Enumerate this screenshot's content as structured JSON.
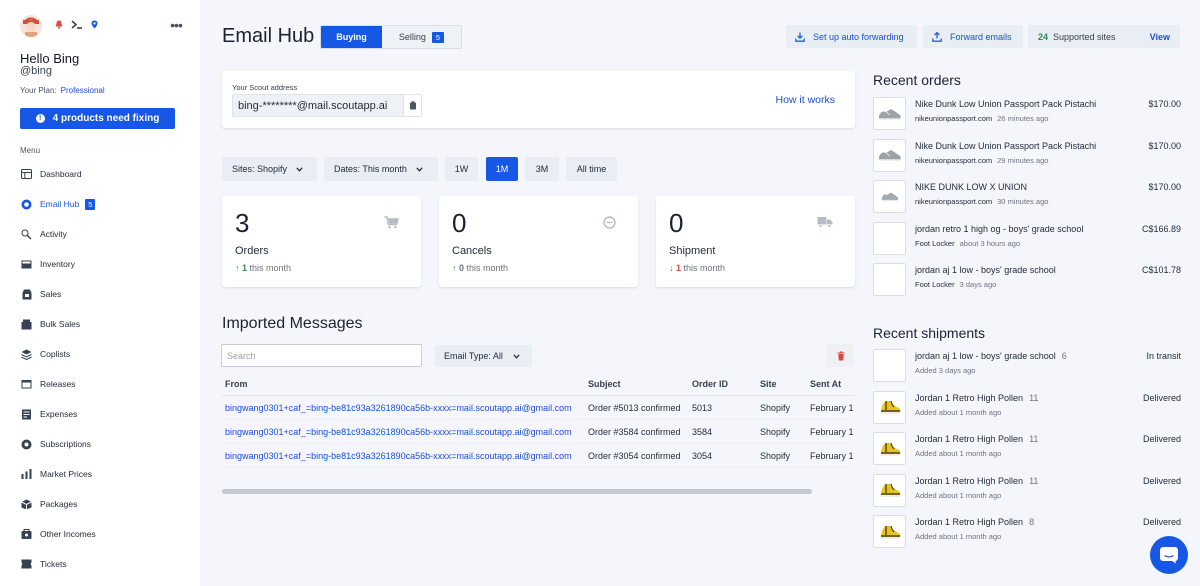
{
  "sidebar": {
    "greeting": "Hello Bing",
    "handle": "@bing",
    "plan_label": "Your Plan:",
    "plan_value": "Professional",
    "fix_button": "4 products need fixing",
    "menu_label": "Menu",
    "items": [
      {
        "label": "Dashboard",
        "icon": "dashboard-icon"
      },
      {
        "label": "Email Hub",
        "icon": "email-hub-icon",
        "badge": "5",
        "active": true
      },
      {
        "label": "Activity",
        "icon": "activity-icon"
      },
      {
        "label": "Inventory",
        "icon": "inventory-icon"
      },
      {
        "label": "Sales",
        "icon": "sales-icon"
      },
      {
        "label": "Bulk Sales",
        "icon": "bulk-sales-icon"
      },
      {
        "label": "Coplists",
        "icon": "coplists-icon"
      },
      {
        "label": "Releases",
        "icon": "releases-icon"
      },
      {
        "label": "Expenses",
        "icon": "expenses-icon"
      },
      {
        "label": "Subscriptions",
        "icon": "subscriptions-icon"
      },
      {
        "label": "Market Prices",
        "icon": "market-prices-icon"
      },
      {
        "label": "Packages",
        "icon": "packages-icon"
      },
      {
        "label": "Other Incomes",
        "icon": "other-incomes-icon"
      },
      {
        "label": "Tickets",
        "icon": "tickets-icon"
      }
    ]
  },
  "header": {
    "title": "Email Hub",
    "tab_buying": "Buying",
    "tab_selling": "Selling",
    "selling_badge": "5",
    "auto_forward": "Set up auto forwarding",
    "forward_emails": "Forward emails",
    "supported_count": "24",
    "supported_label": "Supported sites",
    "view": "View"
  },
  "scout": {
    "label": "Your Scout address",
    "address": "bing-********@mail.scoutapp.ai",
    "how_it_works": "How it works"
  },
  "filters": {
    "sites": "Sites: Shopify",
    "dates": "Dates: This month",
    "ranges": [
      "1W",
      "1M",
      "3M",
      "All time"
    ],
    "active_range": "1M"
  },
  "stats": [
    {
      "value": "3",
      "label": "Orders",
      "change": "1",
      "suffix": "this month",
      "direction": "up",
      "icon": "cart-icon"
    },
    {
      "value": "0",
      "label": "Cancels",
      "change": "0",
      "suffix": "this month",
      "direction": "up",
      "icon": "cancel-circle-icon"
    },
    {
      "value": "0",
      "label": "Shipment",
      "change": "1",
      "suffix": "this month",
      "direction": "down",
      "icon": "truck-icon"
    }
  ],
  "messages": {
    "title": "Imported Messages",
    "search_placeholder": "Search",
    "email_type": "Email Type: All",
    "columns": [
      "From",
      "Subject",
      "Order ID",
      "Site",
      "Sent At"
    ],
    "rows": [
      {
        "from": "bingwang0301+caf_=bing-be81c93a3261890ca56b-xxxx=mail.scoutapp.ai@gmail.com",
        "subject": "Order #5013 confirmed",
        "order_id": "5013",
        "site": "Shopify",
        "sent_at": "February 1"
      },
      {
        "from": "bingwang0301+caf_=bing-be81c93a3261890ca56b-xxxx=mail.scoutapp.ai@gmail.com",
        "subject": "Order #3584 confirmed",
        "order_id": "3584",
        "site": "Shopify",
        "sent_at": "February 1"
      },
      {
        "from": "bingwang0301+caf_=bing-be81c93a3261890ca56b-xxxx=mail.scoutapp.ai@gmail.com",
        "subject": "Order #3054 confirmed",
        "order_id": "3054",
        "site": "Shopify",
        "sent_at": "February 1"
      }
    ]
  },
  "recent_orders": {
    "title": "Recent orders",
    "items": [
      {
        "name": "Nike Dunk Low Union Passport Pack Pistachio",
        "source": "nikeunionpassport.com",
        "time": "26 minutes ago",
        "price": "$170.00",
        "thumb": "sneaker-grey"
      },
      {
        "name": "Nike Dunk Low Union Passport Pack Pistachio",
        "source": "nikeunionpassport.com",
        "time": "29 minutes ago",
        "price": "$170.00",
        "thumb": "sneaker-grey"
      },
      {
        "name": "NIKE DUNK LOW X UNION",
        "source": "nikeunionpassport.com",
        "time": "30 minutes ago",
        "price": "$170.00",
        "thumb": "sneaker-grey-small"
      },
      {
        "name": "jordan retro 1 high og - boys' grade school",
        "source": "Foot Locker",
        "time": "about 3 hours ago",
        "price": "C$166.89",
        "thumb": "blank"
      },
      {
        "name": "jordan aj 1 low - boys' grade school",
        "source": "Foot Locker",
        "time": "3 days ago",
        "price": "C$101.78",
        "thumb": "blank"
      }
    ]
  },
  "recent_shipments": {
    "title": "Recent shipments",
    "items": [
      {
        "name": "jordan aj 1 low - boys' grade school",
        "qty": "6",
        "added": "Added 3 days ago",
        "status": "In transit",
        "thumb": "blank"
      },
      {
        "name": "Jordan 1 Retro High Pollen",
        "qty": "11",
        "added": "Added about 1 month ago",
        "status": "Delivered",
        "thumb": "sneaker-yellow"
      },
      {
        "name": "Jordan 1 Retro High Pollen",
        "qty": "11",
        "added": "Added about 1 month ago",
        "status": "Delivered",
        "thumb": "sneaker-yellow"
      },
      {
        "name": "Jordan 1 Retro High Pollen",
        "qty": "11",
        "added": "Added about 1 month ago",
        "status": "Delivered",
        "thumb": "sneaker-yellow"
      },
      {
        "name": "Jordan 1 Retro High Pollen",
        "qty": "8",
        "added": "Added about 1 month ago",
        "status": "Delivered",
        "thumb": "sneaker-yellow"
      }
    ]
  },
  "colors": {
    "accent": "#1757e6",
    "link": "#1b4fd6",
    "positive": "#2f8a55",
    "negative": "#e0473a"
  }
}
